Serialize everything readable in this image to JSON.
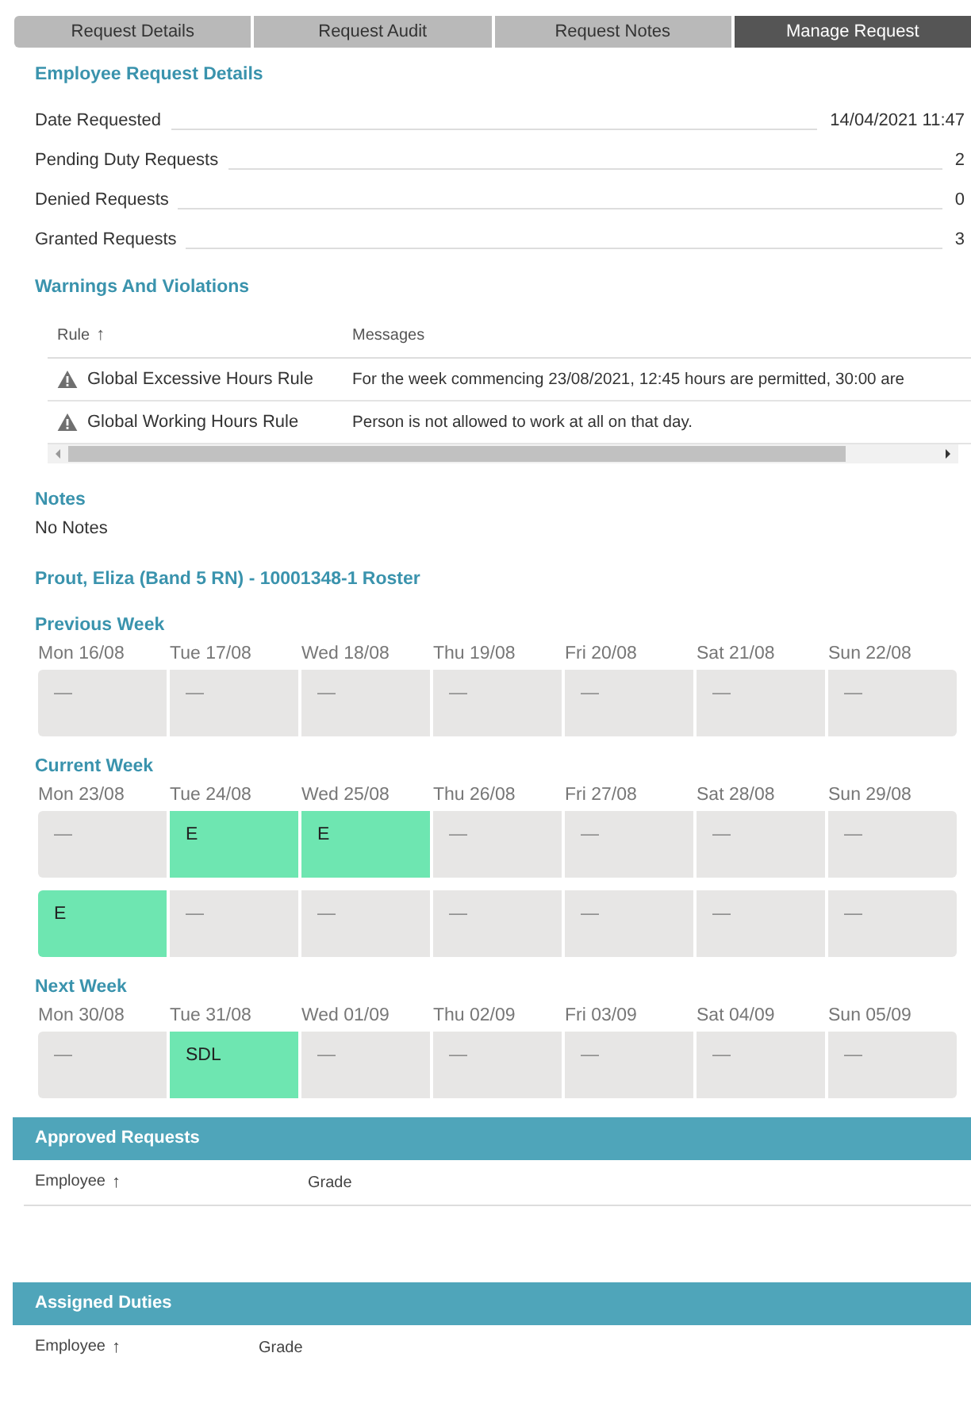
{
  "tabs": [
    {
      "label": "Request Details",
      "selected": false
    },
    {
      "label": "Request Audit",
      "selected": false
    },
    {
      "label": "Request Notes",
      "selected": false
    },
    {
      "label": "Manage Request",
      "selected": true
    }
  ],
  "employee_request_details": {
    "title": "Employee Request Details",
    "rows": [
      {
        "label": "Date Requested",
        "value": "14/04/2021 11:47"
      },
      {
        "label": "Pending Duty Requests",
        "value": "2"
      },
      {
        "label": "Denied Requests",
        "value": "0"
      },
      {
        "label": "Granted Requests",
        "value": "3"
      }
    ]
  },
  "warnings": {
    "title": "Warnings And Violations",
    "columns": [
      {
        "label": "Rule",
        "sort_icon": "↑"
      },
      {
        "label": "Messages"
      }
    ],
    "rows": [
      {
        "rule": "Global Excessive Hours Rule",
        "message": "For the week commencing 23/08/2021, 12:45 hours are permitted, 30:00 are"
      },
      {
        "rule": "Global Working Hours Rule",
        "message": "Person is not allowed to work at all on that day."
      }
    ]
  },
  "notes": {
    "title": "Notes",
    "text": "No Notes"
  },
  "roster": {
    "title": "Prout, Eliza (Band 5 RN) - 10001348-1 Roster",
    "weeks": [
      {
        "title": "Previous Week",
        "days": [
          "Mon 16/08",
          "Tue 17/08",
          "Wed 18/08",
          "Thu 19/08",
          "Fri 20/08",
          "Sat 21/08",
          "Sun 22/08"
        ],
        "rows": [
          [
            {
              "kind": "empty",
              "text": "—"
            },
            {
              "kind": "empty",
              "text": "—"
            },
            {
              "kind": "empty",
              "text": "—"
            },
            {
              "kind": "empty",
              "text": "—"
            },
            {
              "kind": "empty",
              "text": "—"
            },
            {
              "kind": "empty",
              "text": "—"
            },
            {
              "kind": "empty",
              "text": "—"
            }
          ]
        ]
      },
      {
        "title": "Current Week",
        "days": [
          "Mon 23/08",
          "Tue 24/08",
          "Wed 25/08",
          "Thu 26/08",
          "Fri 27/08",
          "Sat 28/08",
          "Sun 29/08"
        ],
        "rows": [
          [
            {
              "kind": "empty",
              "text": "—"
            },
            {
              "kind": "duty",
              "text": "E"
            },
            {
              "kind": "duty",
              "text": "E"
            },
            {
              "kind": "empty",
              "text": "—"
            },
            {
              "kind": "empty",
              "text": "—"
            },
            {
              "kind": "empty",
              "text": "—"
            },
            {
              "kind": "empty",
              "text": "—"
            }
          ],
          [
            {
              "kind": "duty",
              "text": "E"
            },
            {
              "kind": "empty",
              "text": "—"
            },
            {
              "kind": "empty",
              "text": "—"
            },
            {
              "kind": "empty",
              "text": "—"
            },
            {
              "kind": "empty",
              "text": "—"
            },
            {
              "kind": "empty",
              "text": "—"
            },
            {
              "kind": "empty",
              "text": "—"
            }
          ]
        ]
      },
      {
        "title": "Next Week",
        "days": [
          "Mon 30/08",
          "Tue 31/08",
          "Wed 01/09",
          "Thu 02/09",
          "Fri 03/09",
          "Sat 04/09",
          "Sun 05/09"
        ],
        "rows": [
          [
            {
              "kind": "empty",
              "text": "—"
            },
            {
              "kind": "duty",
              "text": "SDL"
            },
            {
              "kind": "empty",
              "text": "—"
            },
            {
              "kind": "empty",
              "text": "—"
            },
            {
              "kind": "empty",
              "text": "—"
            },
            {
              "kind": "empty",
              "text": "—"
            },
            {
              "kind": "empty",
              "text": "—"
            }
          ]
        ]
      }
    ]
  },
  "panels": [
    {
      "title": "Approved Requests",
      "columns": [
        {
          "label": "Employee",
          "sort_icon": "↑"
        },
        {
          "label": "Grade"
        }
      ]
    },
    {
      "title": "Assigned Duties",
      "columns": [
        {
          "label": "Employee",
          "sort_icon": "↑"
        },
        {
          "label": "Grade"
        }
      ]
    }
  ]
}
